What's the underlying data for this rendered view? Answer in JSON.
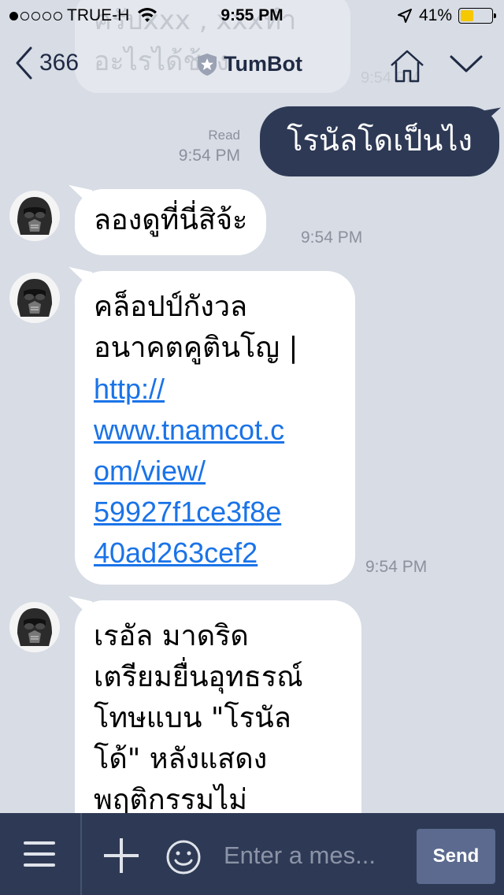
{
  "status_bar": {
    "carrier": "TRUE-H",
    "time": "9:55 PM",
    "battery": "41%",
    "battery_level": 0.41,
    "signal_filled": 1,
    "signal_total": 5
  },
  "ghost": {
    "text": "ครับxxx , xxxทำ อะไรได้ช้าง",
    "time": "9:54 PM"
  },
  "header": {
    "back_count": "366",
    "title": "TumBot"
  },
  "messages": {
    "outgoing": {
      "text": "โรนัลโดเป็นไง",
      "read": "Read",
      "time": "9:54 PM"
    },
    "incoming": [
      {
        "text": "ลองดูที่นี่สิจ้ะ",
        "time": "9:54 PM"
      },
      {
        "line1": "คล็อปป์กังวล",
        "line2": "อนาคตคูตินโญ |",
        "link1": "http://",
        "link2": "www.tnamcot.c",
        "link3": "om/view/",
        "link4": "59927f1ce3f8e",
        "link5": "40ad263cef2",
        "time": "9:54 PM"
      },
      {
        "line1": "เรอัล มาดริด",
        "line2": "เตรียมยื่นอุทธรณ์",
        "line3": "โทษแบน \"โรนัล",
        "line4": "โด้\" หลังแสดง",
        "line5": "พฤติกรรมไม่"
      }
    ]
  },
  "input": {
    "placeholder": "Enter a mes...",
    "send_label": "Send"
  },
  "colors": {
    "background": "#d7dce5",
    "navy": "#2e3a55",
    "link": "#1a73e8",
    "battery": "#f5c800"
  }
}
